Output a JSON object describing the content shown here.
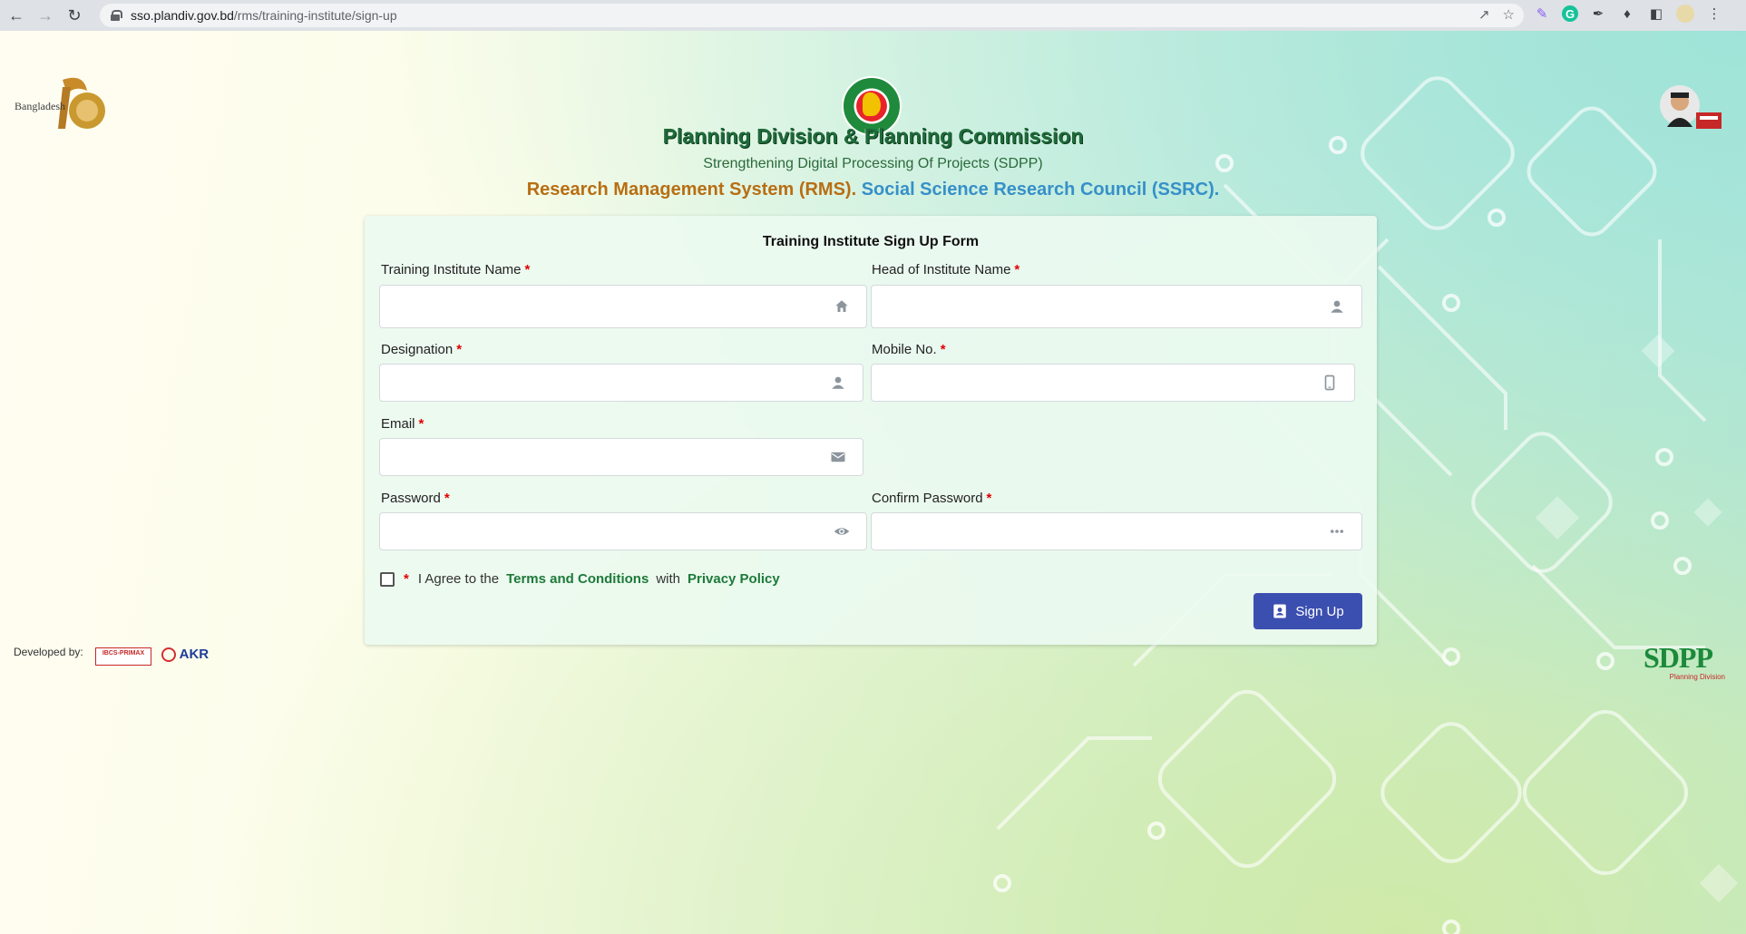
{
  "browser": {
    "url_host": "sso.plandiv.gov.bd",
    "url_path": "/rms/training-institute/sign-up"
  },
  "header": {
    "title": "Planning Division & Planning Commission",
    "subtitle": "Strengthening Digital Processing Of Projects (SDPP)",
    "rms": "Research Management System (RMS).",
    "ssrc": "Social Science Research Council (SSRC)."
  },
  "logos": {
    "left_caption": "Bangladesh",
    "sdpp_text": "SDPP",
    "sdpp_caption": "Planning Division"
  },
  "form": {
    "title": "Training Institute Sign Up Form",
    "fields": {
      "institute_name": {
        "label": "Training Institute Name",
        "value": "",
        "icon": "home-icon"
      },
      "head_name": {
        "label": "Head of Institute Name",
        "value": "",
        "icon": "user-icon"
      },
      "designation": {
        "label": "Designation",
        "value": "",
        "icon": "user-icon"
      },
      "mobile": {
        "label": "Mobile No.",
        "value": "",
        "icon": "phone-icon"
      },
      "email": {
        "label": "Email",
        "value": "",
        "icon": "mail-icon"
      },
      "password": {
        "label": "Password",
        "value": "",
        "icon": "eye-icon"
      },
      "confirm_password": {
        "label": "Confirm Password",
        "value": "",
        "icon": "dots-icon"
      }
    },
    "required_mark": "*",
    "agree": {
      "prefix": "I Agree to the",
      "terms": "Terms and Conditions",
      "with": "with",
      "privacy": "Privacy Policy"
    },
    "submit_label": "Sign Up"
  },
  "footer": {
    "developed_by": "Developed by:",
    "dev_logo_1": "IBCS-PRIMAX",
    "dev_logo_2": "AKR"
  },
  "colors": {
    "title_green": "#1e6b3a",
    "rms_orange": "#b86e12",
    "ssrc_blue": "#3690c8",
    "button_blue": "#3b4fb0",
    "required_red": "#e00000",
    "link_green": "#1d7a3a"
  }
}
